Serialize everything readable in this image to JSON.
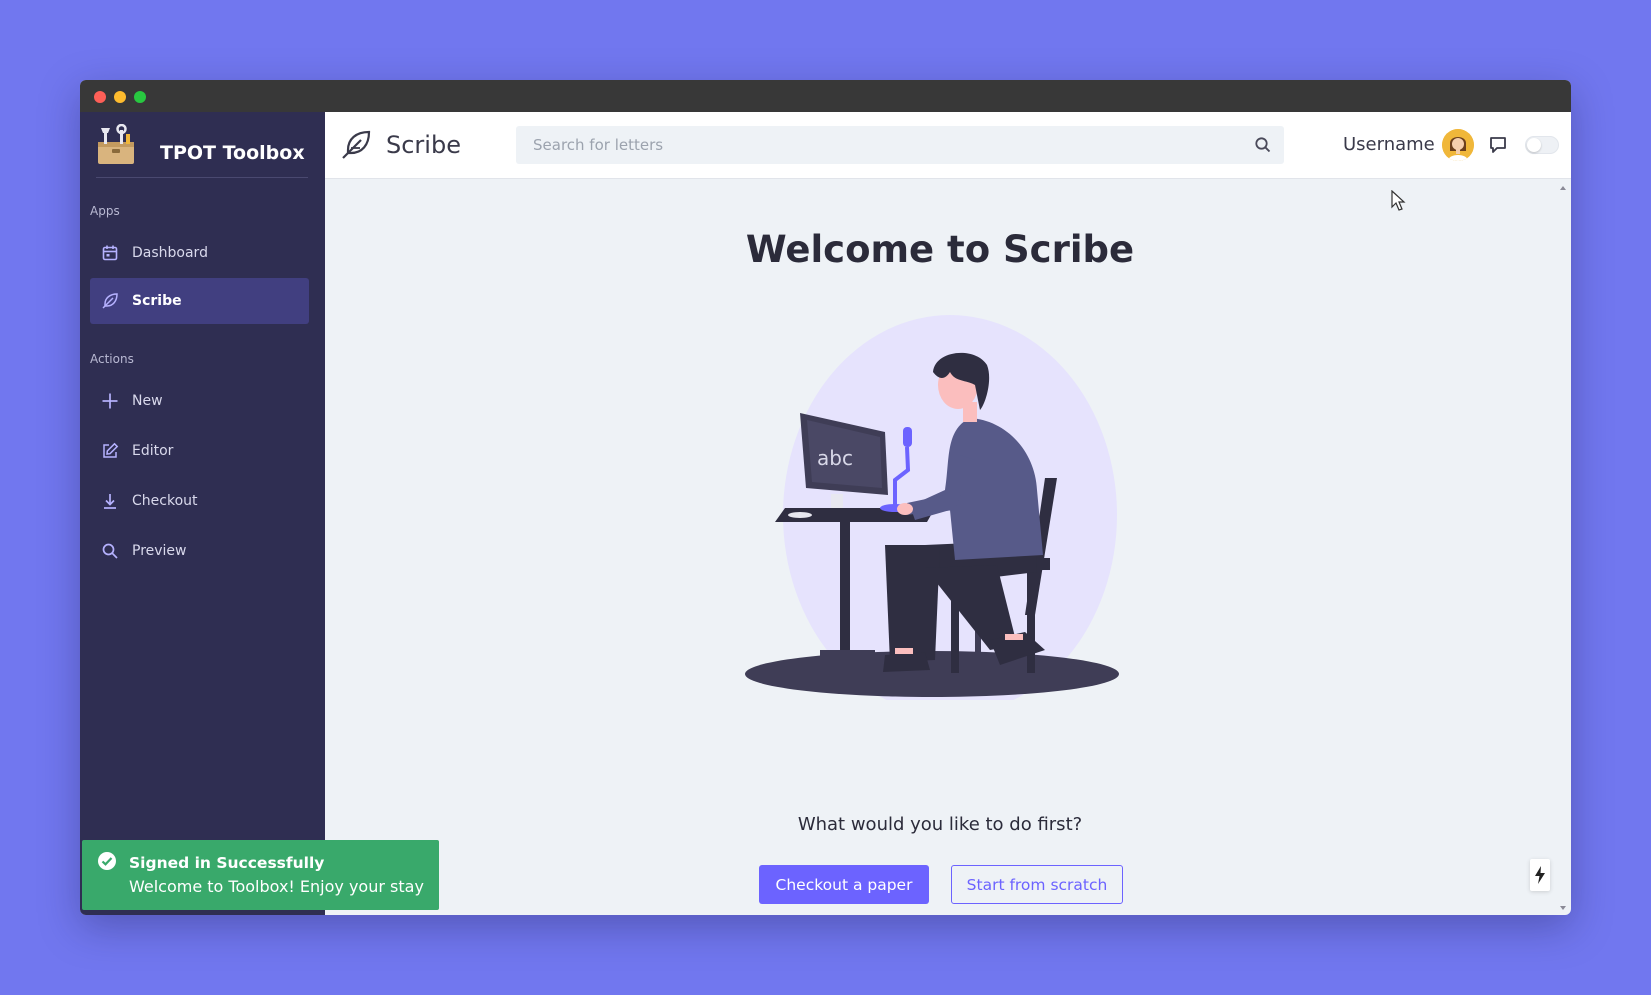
{
  "colors": {
    "background": "#7177ef",
    "sidebar": "#2f2e52",
    "sidebar_active": "#413f80",
    "accent": "#6c63ff",
    "toast": "#39a96b",
    "content_bg": "#eef2f6"
  },
  "sidebar": {
    "brand": {
      "name": "TPOT Toolbox",
      "icon": "toolbox-icon"
    },
    "sections": [
      {
        "label": "Apps",
        "items": [
          {
            "label": "Dashboard",
            "icon": "calendar-icon",
            "active": false
          },
          {
            "label": "Scribe",
            "icon": "feather-icon",
            "active": true
          }
        ]
      },
      {
        "label": "Actions",
        "items": [
          {
            "label": "New",
            "icon": "plus-icon",
            "active": false
          },
          {
            "label": "Editor",
            "icon": "edit-icon",
            "active": false
          },
          {
            "label": "Checkout",
            "icon": "download-icon",
            "active": false
          },
          {
            "label": "Preview",
            "icon": "search-icon",
            "active": false
          }
        ]
      }
    ]
  },
  "header": {
    "app_title": "Scribe",
    "app_icon": "feather-icon",
    "search": {
      "placeholder": "Search for letters",
      "value": "",
      "icon": "search-icon"
    },
    "username": "Username",
    "avatar": "user-avatar",
    "chat_icon": "chat-icon",
    "theme_toggle": {
      "on": false
    }
  },
  "main": {
    "title": "Welcome to Scribe",
    "prompt": "What would you like to do first?",
    "primary_button": "Checkout a paper",
    "secondary_button": "Start from scratch"
  },
  "screen_text": {
    "illustration_monitor": "abc"
  },
  "toast": {
    "title": "Signed in Successfully",
    "message": "Welcome to Toolbox! Enjoy your stay",
    "icon": "check-circle-icon"
  },
  "floating_button": {
    "icon": "lightning-icon"
  }
}
